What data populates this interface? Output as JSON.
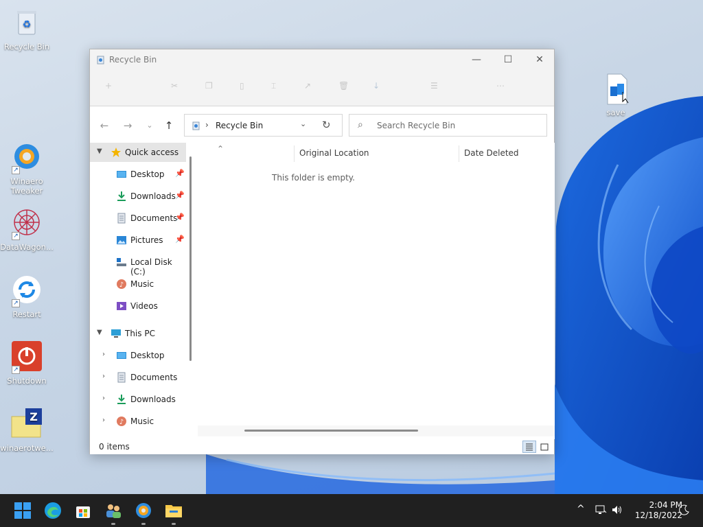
{
  "desktop": {
    "icons": [
      {
        "label": "Recycle Bin"
      },
      {
        "label": "Winaero\nTweaker"
      },
      {
        "label": "DataWagon..."
      },
      {
        "label": "Restart"
      },
      {
        "label": "Shutdown"
      },
      {
        "label": "winaerotwe..."
      },
      {
        "label": "save"
      }
    ]
  },
  "window": {
    "title": "Recycle Bin",
    "minimize": "—",
    "maximize": "☐",
    "close": "✕",
    "address": {
      "separator": "›",
      "location": "Recycle Bin",
      "dropdown": "⌄",
      "refresh": "↻"
    },
    "search": {
      "placeholder": "Search Recycle Bin",
      "icon": "search-icon"
    },
    "nav": {
      "back": "←",
      "forward": "→",
      "recent": "⌄",
      "up": "↑"
    },
    "navpane": {
      "quick_access": "Quick access",
      "quick_items": [
        {
          "label": "Desktop",
          "pinned": true
        },
        {
          "label": "Downloads",
          "pinned": true
        },
        {
          "label": "Documents",
          "pinned": true
        },
        {
          "label": "Pictures",
          "pinned": true
        },
        {
          "label": "Local Disk (C:)",
          "pinned": false
        },
        {
          "label": "Music",
          "pinned": false
        },
        {
          "label": "Videos",
          "pinned": false
        }
      ],
      "this_pc": "This PC",
      "pc_items": [
        {
          "label": "Desktop"
        },
        {
          "label": "Documents"
        },
        {
          "label": "Downloads"
        },
        {
          "label": "Music"
        }
      ]
    },
    "columns": {
      "name_sort": "⌃",
      "original_location": "Original Location",
      "date_deleted": "Date Deleted"
    },
    "empty_message": "This folder is empty.",
    "status": {
      "items": "0 items"
    }
  },
  "taskbar": {
    "time": "2:04 PM",
    "date": "12/18/2022",
    "tray_chevron": "^"
  },
  "colors": {
    "accent": "#0067c0",
    "taskbar": "#202020",
    "selected": "#e5e5e5"
  }
}
